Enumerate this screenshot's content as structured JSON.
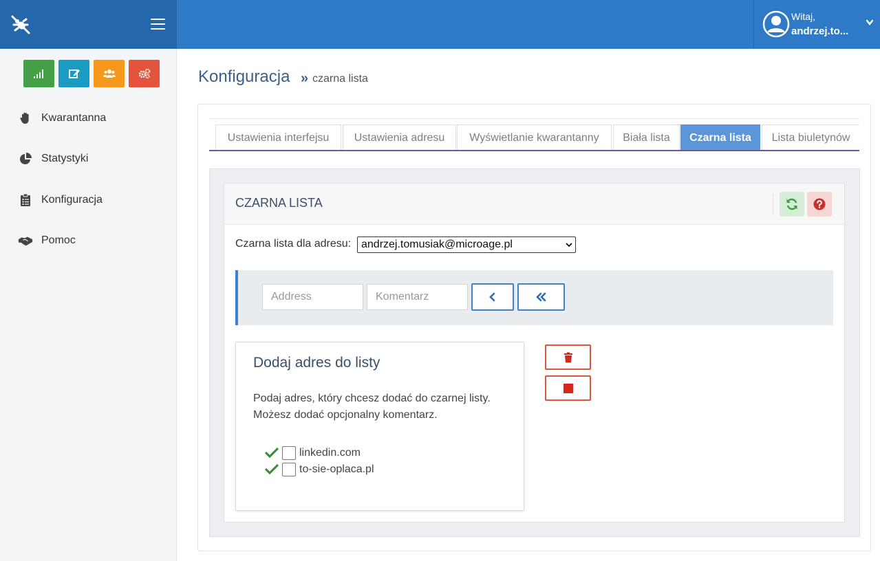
{
  "header": {
    "greeting_line1": "Witaj,",
    "greeting_line2": "andrzej.to...",
    "colors": {
      "topbar": "#2f7ac7",
      "logo_area": "#2567ab"
    }
  },
  "sidebar": {
    "quick_buttons": [
      {
        "icon": "signal-bars-icon",
        "color": "#44a047"
      },
      {
        "icon": "edit-icon",
        "color": "#1b9bc2"
      },
      {
        "icon": "users-icon",
        "color": "#f6981c"
      },
      {
        "icon": "cogs-icon",
        "color": "#e4533b"
      }
    ],
    "items": [
      {
        "label": "Kwarantanna",
        "icon": "hand-icon"
      },
      {
        "label": "Statystyki",
        "icon": "pie-chart-icon"
      },
      {
        "label": "Konfiguracja",
        "icon": "clipboard-icon"
      },
      {
        "label": "Pomoc",
        "icon": "handshake-icon"
      }
    ]
  },
  "page": {
    "title": "Konfiguracja",
    "breadcrumb_sep": "»",
    "breadcrumb": "czarna lista"
  },
  "tabs": [
    {
      "label": "Ustawienia interfejsu",
      "active": false
    },
    {
      "label": "Ustawienia adresu",
      "active": false
    },
    {
      "label": "Wyświetlanie kwarantanny",
      "active": false
    },
    {
      "label": "Biała lista",
      "active": false
    },
    {
      "label": "Czarna lista",
      "active": true
    },
    {
      "label": "Lista biuletynów",
      "active": false
    }
  ],
  "panel": {
    "title": "CZARNA LISTA",
    "address_label": "Czarna lista dla adresu:",
    "address_selected": "andrzej.tomusiak@microage.pl",
    "address_placeholder": "Address",
    "comment_placeholder": "Komentarz"
  },
  "info": {
    "title": "Dodaj adres do listy",
    "text_line1": "Podaj adres, który chcesz dodać do czarnej listy.",
    "text_line2": "Możesz dodać opcjonalny komentarz.",
    "entries": [
      "linkedin.com",
      "to-sie-oplaca.pl"
    ]
  }
}
